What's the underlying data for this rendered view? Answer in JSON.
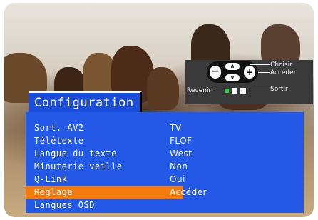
{
  "menu": {
    "title": "Configuration",
    "items": [
      {
        "label": "Sort. AV2",
        "value": "TV"
      },
      {
        "label": "Télétexte",
        "value": "FLOF"
      },
      {
        "label": "Langue du texte",
        "value": "West"
      },
      {
        "label": "Minuterie veille",
        "value": "Non"
      },
      {
        "label": "Q-Link",
        "value": "Oui"
      },
      {
        "label": "Réglage",
        "value": "Accéder",
        "selected": true
      },
      {
        "label": "Langues OSD",
        "value": ""
      }
    ]
  },
  "help": {
    "choisir": "Choisir",
    "acceder": "Accéder",
    "revenir": "Revenir",
    "sortir": "Sortir"
  },
  "colors": {
    "panel": "#2458e6",
    "highlight": "#f37a0c",
    "title_bg": "#1a4dd9"
  }
}
